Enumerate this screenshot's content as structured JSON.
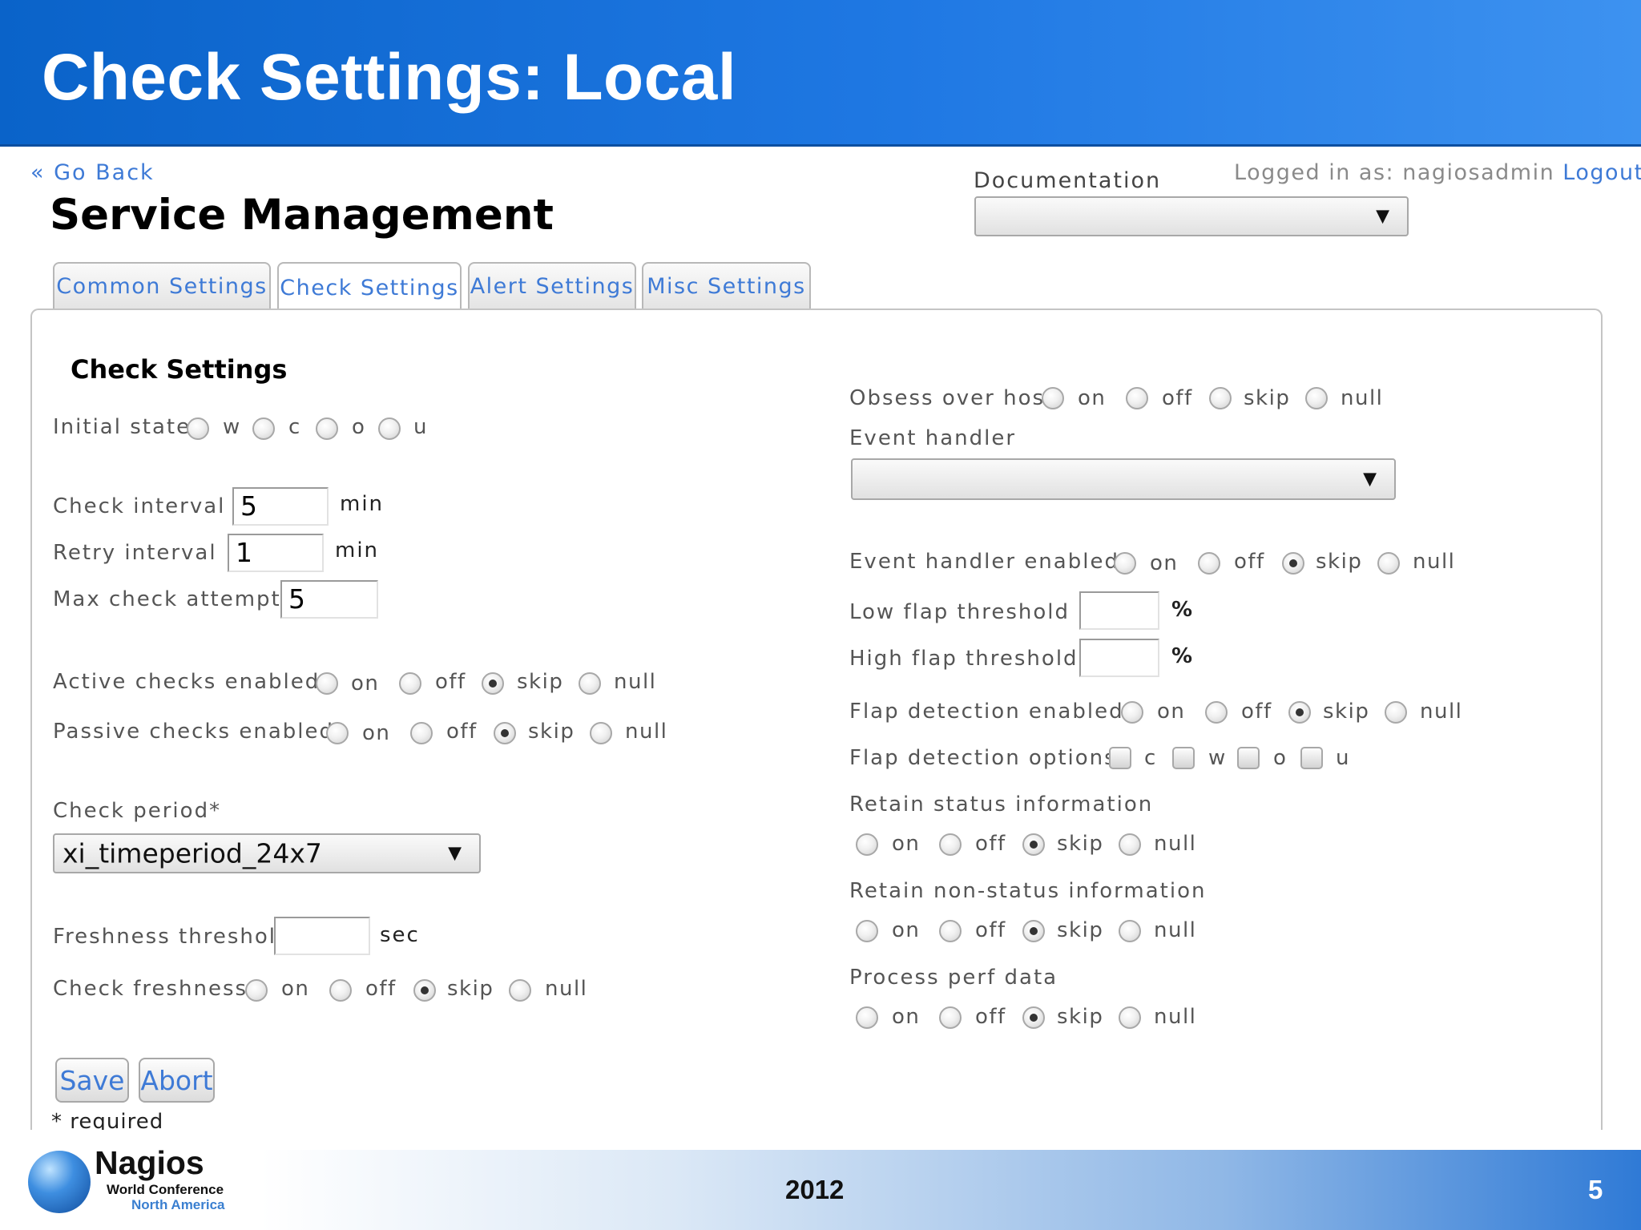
{
  "slide": {
    "title": "Check Settings: Local",
    "year": "2012",
    "page_number": "5"
  },
  "logo": {
    "name": "Nagios",
    "line1": "World Conference",
    "line2": "North America"
  },
  "header": {
    "go_back": "« Go Back",
    "page_title": "Service Management",
    "documentation_label": "Documentation",
    "logged_in_prefix": "Logged in as:",
    "username": "nagiosadmin",
    "logout": "Logout"
  },
  "tabs": [
    {
      "label": "Common Settings"
    },
    {
      "label": "Check Settings",
      "active": true
    },
    {
      "label": "Alert Settings"
    },
    {
      "label": "Misc Settings"
    }
  ],
  "section_title": "Check Settings",
  "options": {
    "on": "on",
    "off": "off",
    "skip": "skip",
    "null": "null"
  },
  "left": {
    "initial_state": {
      "label": "Initial state",
      "options": [
        "w",
        "c",
        "o",
        "u"
      ]
    },
    "check_interval": {
      "label": "Check interval",
      "value": "5",
      "unit": "min"
    },
    "retry_interval": {
      "label": "Retry interval",
      "value": "1",
      "unit": "min"
    },
    "max_check_attempts": {
      "label": "Max check attempts",
      "value": "5"
    },
    "active_checks": {
      "label": "Active checks enabled",
      "selected": "skip"
    },
    "passive_checks": {
      "label": "Passive checks enabled",
      "selected": "skip"
    },
    "check_period": {
      "label": "Check period*",
      "value": "xi_timeperiod_24x7"
    },
    "freshness_threshold": {
      "label": "Freshness threshold",
      "value": "",
      "unit": "sec"
    },
    "check_freshness": {
      "label": "Check freshness",
      "selected": "skip"
    }
  },
  "right": {
    "obsess_over_host": {
      "label": "Obsess over host",
      "selected": "none"
    },
    "event_handler": {
      "label": "Event handler",
      "value": ""
    },
    "event_handler_enabled": {
      "label": "Event handler enabled",
      "selected": "skip"
    },
    "low_flap": {
      "label": "Low flap threshold",
      "value": "",
      "unit": "%"
    },
    "high_flap": {
      "label": "High flap threshold",
      "value": "",
      "unit": "%"
    },
    "flap_detection_enabled": {
      "label": "Flap detection enabled",
      "selected": "skip"
    },
    "flap_detection_options": {
      "label": "Flap detection options",
      "options": [
        "c",
        "w",
        "o",
        "u"
      ]
    },
    "retain_status": {
      "label": "Retain status information",
      "selected": "skip"
    },
    "retain_nonstatus": {
      "label": "Retain non-status information",
      "selected": "skip"
    },
    "process_perf_data": {
      "label": "Process perf data",
      "selected": "skip"
    }
  },
  "buttons": {
    "save": "Save",
    "abort": "Abort"
  },
  "required_note": "* required",
  "colors": {
    "header_blue": "#1f78e3",
    "link_blue": "#3e7ad6"
  }
}
